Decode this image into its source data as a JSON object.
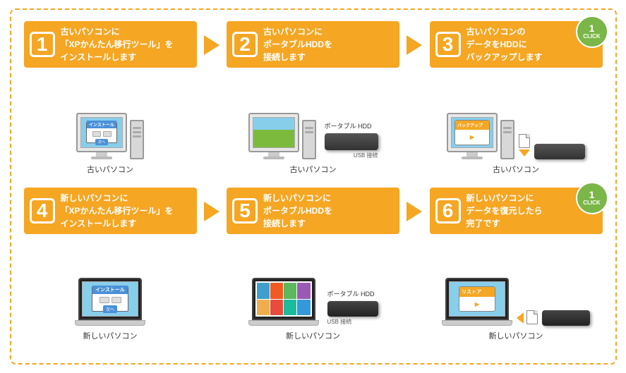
{
  "outer_border_color": "#f5a623",
  "steps": [
    {
      "id": 1,
      "number": "1",
      "text": "古いパソコンに\n「XPかんたん移行ツール」を\nインストールします",
      "label": "古いパソコン",
      "has_click": false,
      "type": "old-pc-install"
    },
    {
      "id": 2,
      "number": "2",
      "text": "古いパソコンに\nポータブルHDDを\n接続します",
      "label": "古いパソコン",
      "has_click": false,
      "type": "old-pc-hdd"
    },
    {
      "id": 3,
      "number": "3",
      "text": "古いパソコンの\nデータをHDDに\nバックアップします",
      "label": "古いパソコン",
      "has_click": true,
      "type": "old-pc-backup"
    },
    {
      "id": 4,
      "number": "4",
      "text": "新しいパソコンに\n「XPかんたん移行ツール」を\nインストールします",
      "label": "新しいパソコン",
      "has_click": false,
      "type": "new-pc-install"
    },
    {
      "id": 5,
      "number": "5",
      "text": "新しいパソコンに\nポータブルHDDを\n接続します",
      "label": "新しいパソコン",
      "has_click": false,
      "type": "new-pc-hdd"
    },
    {
      "id": 6,
      "number": "6",
      "text": "新しいパソコンに\nデータを復元したら\n完了です",
      "label": "新しいパソコン",
      "has_click": true,
      "type": "new-pc-restore"
    }
  ],
  "click_label": "CLICK",
  "click_number": "1",
  "hdd_label": "ポータブル HDD",
  "usb_label": "USB 接続",
  "install_text": "インストール",
  "backup_text": "バックアップ",
  "restore_text": "リストア"
}
